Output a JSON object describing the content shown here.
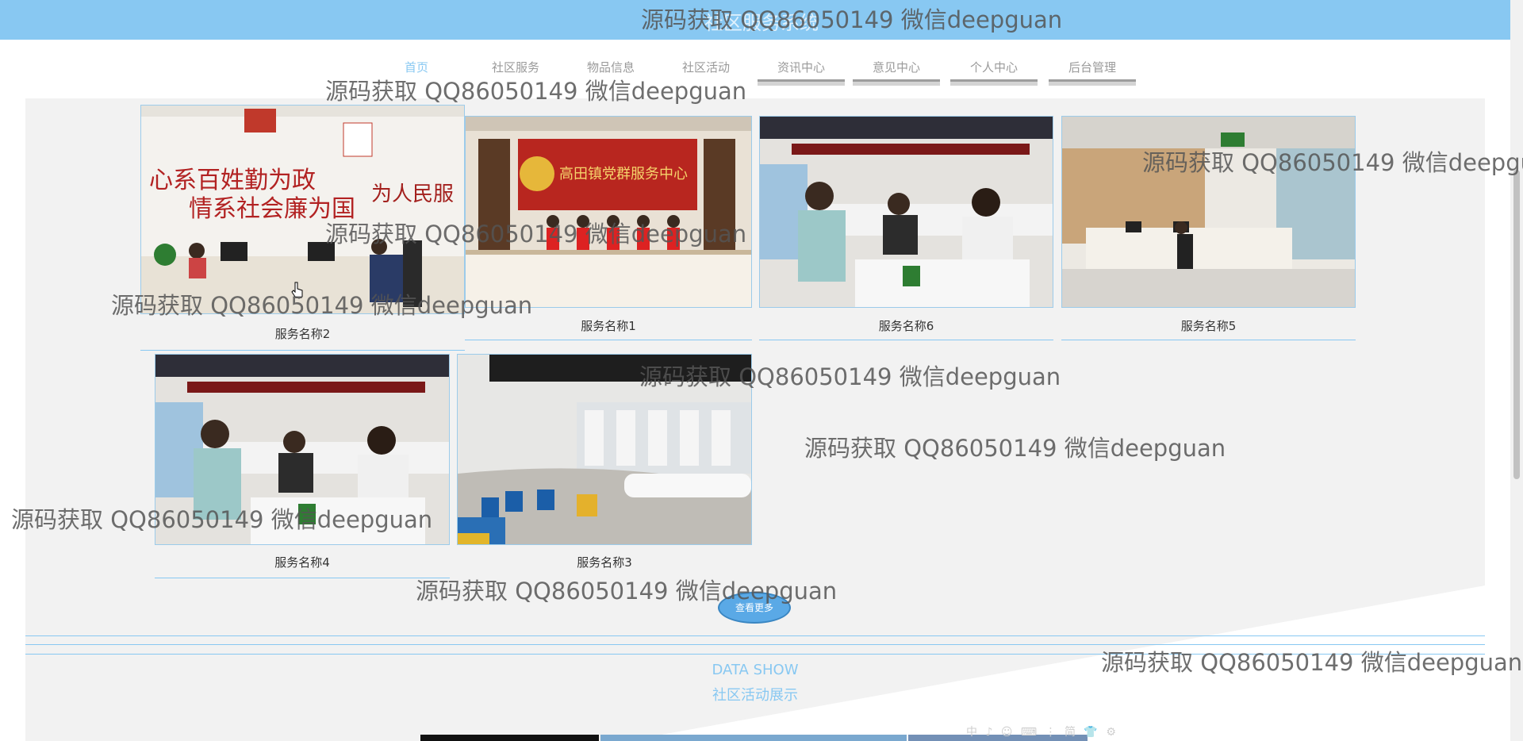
{
  "app_title": "社区服务系统",
  "nav": [
    {
      "label": "首页",
      "active": true
    },
    {
      "label": "社区服务"
    },
    {
      "label": "物品信息"
    },
    {
      "label": "社区活动"
    },
    {
      "label": "资讯中心"
    },
    {
      "label": "意见中心"
    },
    {
      "label": "个人中心"
    },
    {
      "label": "后台管理"
    }
  ],
  "services": [
    {
      "name": "服务名称2",
      "scene": "office-wall-slogan"
    },
    {
      "name": "服务名称1",
      "scene": "service-center-staff"
    },
    {
      "name": "服务名称6",
      "scene": "consultation-desk"
    },
    {
      "name": "服务名称5",
      "scene": "service-hall"
    },
    {
      "name": "服务名称4",
      "scene": "consultation-desk"
    },
    {
      "name": "服务名称3",
      "scene": "waiting-hall"
    }
  ],
  "more_button": "查看更多",
  "section": {
    "en": "DATA SHOW",
    "cn": "社区活动展示"
  },
  "ime_toolbar": "中 ♪ ☺ ⌨ ⋮ 简 👕 ⚙",
  "watermark": "源码获取 QQ86050149 微信deepguan",
  "colors": {
    "accent": "#88c8f2",
    "content_bg": "#f2f2f2",
    "button": "#5aa9e6"
  }
}
